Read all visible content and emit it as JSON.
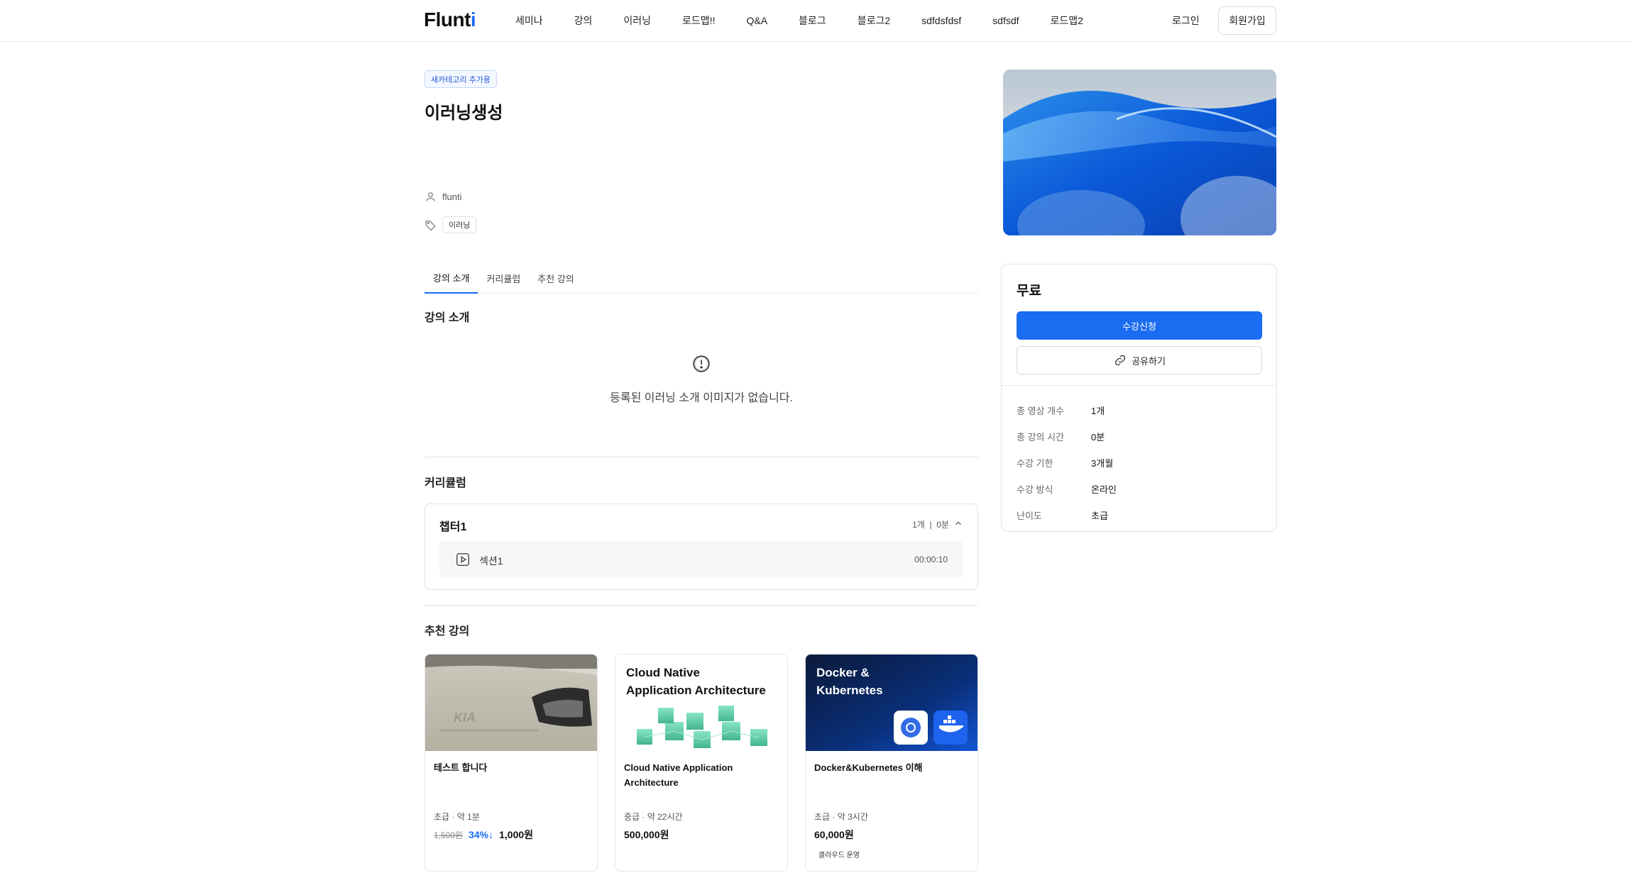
{
  "header": {
    "logo": "Flunti",
    "nav": [
      "세미나",
      "강의",
      "이러닝",
      "로드맵!!",
      "Q&A",
      "블로그",
      "블로그2",
      "sdfdsfdsf",
      "sdfsdf",
      "로드맵2"
    ],
    "login": "로그인",
    "signup": "회원가입"
  },
  "course": {
    "category_badge": "새카테고리 추가용",
    "title": "이러닝생성",
    "instructor": "flunti",
    "tag": "이러닝"
  },
  "tabs": [
    "강의 소개",
    "커리큘럼",
    "추천 강의"
  ],
  "intro": {
    "title": "강의 소개",
    "empty_message": "등록된 이러닝 소개 이미지가 없습니다."
  },
  "curriculum": {
    "title": "커리큘럼",
    "chapter": {
      "name": "챕터1",
      "meta": "1개  |  0분",
      "lessons": [
        {
          "name": "섹션1",
          "duration": "00:00:10"
        }
      ]
    }
  },
  "recommended": {
    "title": "추천 강의",
    "cards": [
      {
        "title": "테스트 합니다",
        "meta": "초급 · 약 1분",
        "orig_price": "1,500원",
        "discount": "34%↓",
        "price": "1,000원",
        "thumb_text": "",
        "badge": ""
      },
      {
        "title": "Cloud Native Application Architecture",
        "meta": "중급 · 약 22시간",
        "orig_price": "",
        "discount": "",
        "price": "500,000원",
        "thumb_text": "Cloud Native\nApplication Architecture",
        "badge": ""
      },
      {
        "title": "Docker&Kubernetes 이해",
        "meta": "초급 · 약 3시간",
        "orig_price": "",
        "discount": "",
        "price": "60,000원",
        "thumb_text": "Docker &\nKubernetes",
        "badge": "클라우드 운영"
      }
    ]
  },
  "sidebar": {
    "price": "무료",
    "enroll": "수강신청",
    "share": "공유하기",
    "info": [
      {
        "label": "총 영상 개수",
        "value": "1개"
      },
      {
        "label": "총 강의 시간",
        "value": "0분"
      },
      {
        "label": "수강 기한",
        "value": "3개월"
      },
      {
        "label": "수강 방식",
        "value": "온라인"
      },
      {
        "label": "난이도",
        "value": "초급"
      }
    ]
  },
  "colors": {
    "accent": "#1a6cf0",
    "border": "#e2e2e2"
  },
  "icons": [
    "user-icon",
    "tag-icon",
    "info-circle-icon",
    "chevron-up-icon",
    "play-icon",
    "link-icon"
  ]
}
